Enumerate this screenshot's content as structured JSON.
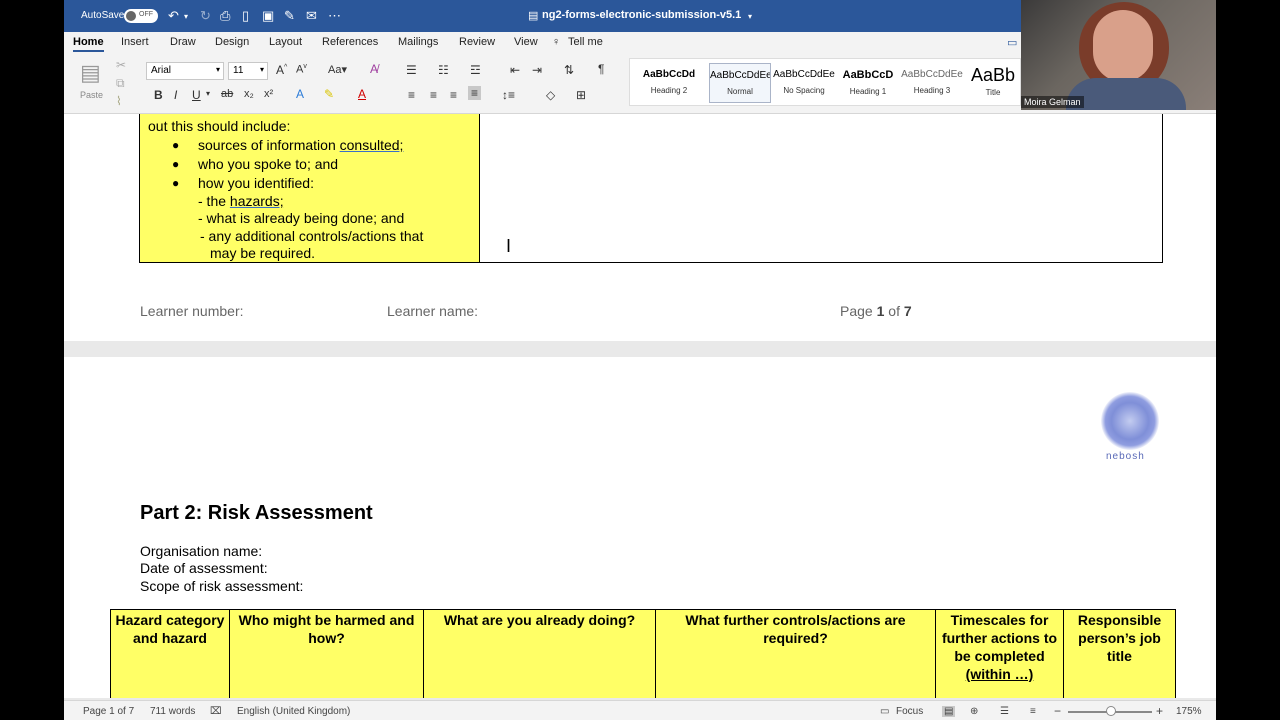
{
  "titlebar": {
    "autosave_label": "AutoSave",
    "autosave_state": "OFF",
    "document_name": "ng2-forms-electronic-submission-v5.1"
  },
  "tabs": [
    "Home",
    "Insert",
    "Draw",
    "Design",
    "Layout",
    "References",
    "Mailings",
    "Review",
    "View",
    "Tell me"
  ],
  "ribbon": {
    "paste_label": "Paste",
    "font_name": "Arial",
    "font_size": "11",
    "styles": [
      {
        "preview": "AaBbCcDd",
        "name": "Heading 2"
      },
      {
        "preview": "AaBbCcDdEe",
        "name": "Normal"
      },
      {
        "preview": "AaBbCcDdEe",
        "name": "No Spacing"
      },
      {
        "preview": "AaBbCcD",
        "name": "Heading 1"
      },
      {
        "preview": "AaBbCcDdEe",
        "name": "Heading 3"
      },
      {
        "preview": "AaBb",
        "name": "Title"
      }
    ]
  },
  "page1": {
    "intro": "out this should include:",
    "bullets": [
      "sources of information ",
      "consulted;",
      "who you spoke to; and",
      "how you identified:"
    ],
    "sub_prefix": "- the ",
    "sub_hazards": "hazards;",
    "sub2": "- what is already being done; and",
    "sub3a": "- any additional controls/actions that",
    "sub3b": "may be required.",
    "footer_learner_number": "Learner number:",
    "footer_learner_name": "Learner name:",
    "footer_page_prefix": "Page ",
    "footer_page_current": "1",
    "footer_page_mid": " of ",
    "footer_page_total": "7"
  },
  "page2": {
    "logo_text": "nebosh",
    "heading": "Part 2: Risk Assessment",
    "org_label": "Organisation name:",
    "date_label": "Date of assessment:",
    "scope_label": "Scope of risk assessment:",
    "table_headers": [
      "Hazard category and hazard",
      "Who might be harmed and how?",
      "What are you already doing?",
      "What further controls/actions are required?",
      "Timescales for further actions to be completed",
      "Responsible person’s job title"
    ],
    "timescale_suffix": "(within …)"
  },
  "status": {
    "page": "Page 1 of 7",
    "words": "711 words",
    "language": "English (United Kingdom)",
    "focus": "Focus",
    "zoom": "175%"
  },
  "video": {
    "participant": "Moira Gelman"
  }
}
